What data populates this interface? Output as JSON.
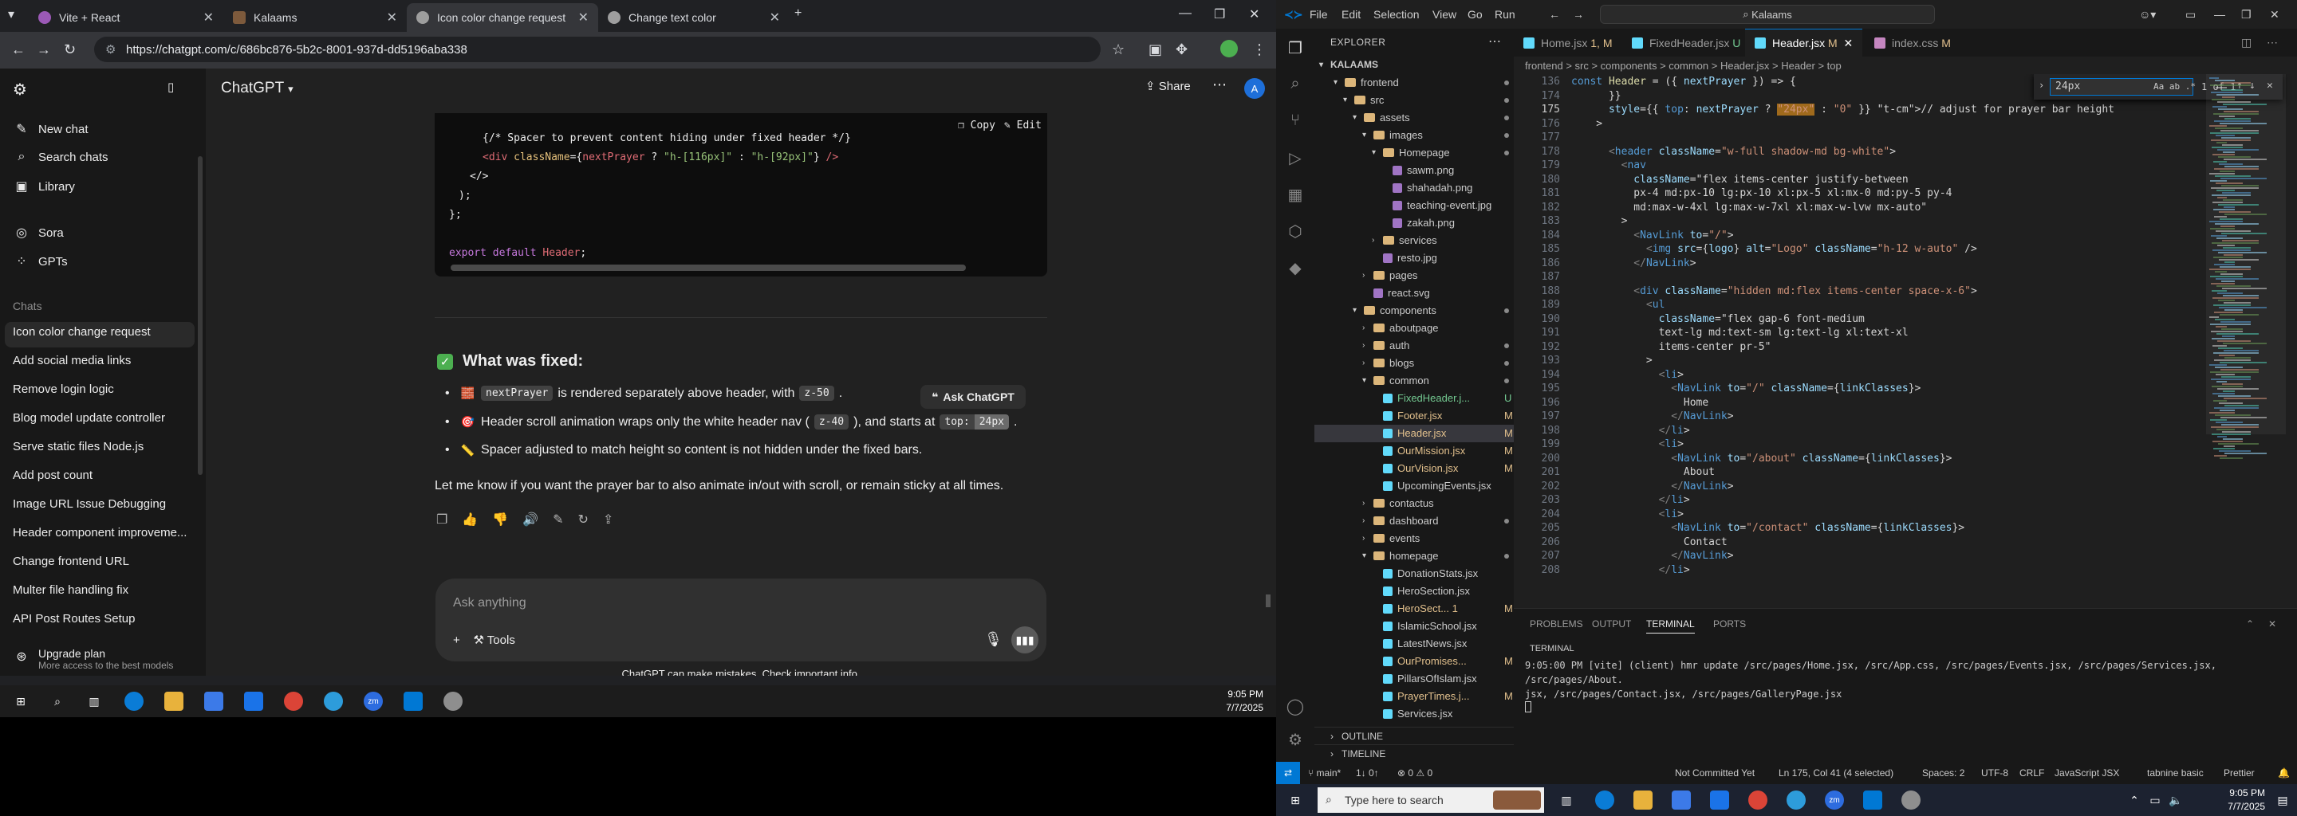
{
  "chrome": {
    "tabs": [
      {
        "title": "Vite + React",
        "color": "#9b59b6"
      },
      {
        "title": "Kalaams",
        "color": "#7d5a3c"
      },
      {
        "title": "Icon color change request",
        "color": "#9e9e9e"
      },
      {
        "title": "Change text color",
        "color": "#9e9e9e"
      }
    ],
    "new_tab": "+",
    "url": "https://chatgpt.com/c/686bc876-5b2c-8001-937d-dd5196aba338"
  },
  "chatgpt": {
    "sidebar": {
      "top_items": [
        {
          "label": "New chat",
          "icon": "edit-icon"
        },
        {
          "label": "Search chats",
          "icon": "search-icon"
        },
        {
          "label": "Library",
          "icon": "library-icon"
        },
        {
          "label": "Sora",
          "icon": "sora-icon"
        },
        {
          "label": "GPTs",
          "icon": "gpts-icon"
        }
      ],
      "chats_heading": "Chats",
      "chats": [
        "Icon color change request",
        "Add social media links",
        "Remove login logic",
        "Blog model update controller",
        "Serve static files Node.js",
        "Add post count",
        "Image URL Issue Debugging",
        "Header component improveme...",
        "Change frontend URL",
        "Multer file handling fix",
        "API Post Routes Setup"
      ],
      "upgrade_title": "Upgrade plan",
      "upgrade_sub": "More access to the best models"
    },
    "model": "ChatGPT",
    "share": "Share",
    "avatar": "A",
    "code_block": {
      "copy": "Copy",
      "edit": "Edit",
      "lines": [
        "{/* Spacer to prevent content hiding under fixed header */}",
        "<div className={nextPrayer ? \"h-[116px]\" : \"h-[92px]\"} />",
        "</>",
        ");",
        "};",
        "",
        "export default Header;"
      ]
    },
    "fixed_heading": "What was fixed:",
    "bullets": [
      {
        "emoji": "🧱",
        "code": "nextPrayer",
        "text_a": "is rendered separately above header, with",
        "code_b": "z-50",
        "text_b": "."
      },
      {
        "emoji": "🎯",
        "text_a": "Header scroll animation wraps only the white header nav (",
        "code": "z-40",
        "text_b": "), and starts at",
        "code_b": "top:",
        "code_c": "24px",
        "text_c": "."
      },
      {
        "emoji": "📏",
        "text_a": "Spacer adjusted to match height so content is not hidden under the fixed bars."
      }
    ],
    "closing": "Let me know if you want the prayer bar to also animate in/out with scroll, or remain sticky at all times.",
    "ask_chatgpt": "Ask ChatGPT",
    "composer_placeholder": "Ask anything",
    "tools": "Tools",
    "disclaimer": "ChatGPT can make mistakes. Check important info."
  },
  "taskbar_left": {
    "time": "9:05 PM",
    "date": "7/7/2025"
  },
  "vscode": {
    "menu": [
      "File",
      "Edit",
      "Selection",
      "View",
      "Go",
      "Run"
    ],
    "search": "Kalaams",
    "explorer_title": "EXPLORER",
    "root": "KALAAMS",
    "tree": [
      {
        "label": "frontend",
        "type": "folder",
        "depth": 1,
        "open": true,
        "badge": "dot"
      },
      {
        "label": "src",
        "type": "folder",
        "depth": 2,
        "open": true,
        "badge": "dot"
      },
      {
        "label": "assets",
        "type": "folder",
        "depth": 3,
        "open": true,
        "badge": "dot"
      },
      {
        "label": "images",
        "type": "folder",
        "depth": 4,
        "open": true,
        "badge": "dot"
      },
      {
        "label": "Homepage",
        "type": "folder",
        "depth": 5,
        "open": true,
        "badge": "dot"
      },
      {
        "label": "sawm.png",
        "type": "img",
        "depth": 6,
        "badge": ""
      },
      {
        "label": "shahadah.png",
        "type": "img",
        "depth": 6,
        "badge": ""
      },
      {
        "label": "teaching-event.jpg",
        "type": "img",
        "depth": 6,
        "badge": ""
      },
      {
        "label": "zakah.png",
        "type": "img",
        "depth": 6,
        "badge": ""
      },
      {
        "label": "services",
        "type": "folder",
        "depth": 5,
        "open": false,
        "badge": ""
      },
      {
        "label": "resto.jpg",
        "type": "img",
        "depth": 5,
        "badge": ""
      },
      {
        "label": "pages",
        "type": "folder",
        "depth": 4,
        "open": false,
        "badge": ""
      },
      {
        "label": "react.svg",
        "type": "img",
        "depth": 4,
        "badge": ""
      },
      {
        "label": "components",
        "type": "folder",
        "depth": 3,
        "open": true,
        "badge": "dot"
      },
      {
        "label": "aboutpage",
        "type": "folder",
        "depth": 4,
        "open": false,
        "badge": ""
      },
      {
        "label": "auth",
        "type": "folder",
        "depth": 4,
        "open": false,
        "badge": "dot"
      },
      {
        "label": "blogs",
        "type": "folder",
        "depth": 4,
        "open": false,
        "badge": "dot"
      },
      {
        "label": "common",
        "type": "folder",
        "depth": 4,
        "open": true,
        "badge": "dot"
      },
      {
        "label": "FixedHeader.j...",
        "type": "jsx",
        "depth": 5,
        "badge": "U"
      },
      {
        "label": "Footer.jsx",
        "type": "jsx",
        "depth": 5,
        "badge": "M"
      },
      {
        "label": "Header.jsx",
        "type": "jsx",
        "depth": 5,
        "badge": "M",
        "selected": true
      },
      {
        "label": "OurMission.jsx",
        "type": "jsx",
        "depth": 5,
        "badge": "M"
      },
      {
        "label": "OurVision.jsx",
        "type": "jsx",
        "depth": 5,
        "badge": "M"
      },
      {
        "label": "UpcomingEvents.jsx",
        "type": "jsx",
        "depth": 5,
        "badge": ""
      },
      {
        "label": "contactus",
        "type": "folder",
        "depth": 4,
        "open": false,
        "badge": ""
      },
      {
        "label": "dashboard",
        "type": "folder",
        "depth": 4,
        "open": false,
        "badge": "dot"
      },
      {
        "label": "events",
        "type": "folder",
        "depth": 4,
        "open": false,
        "badge": ""
      },
      {
        "label": "homepage",
        "type": "folder",
        "depth": 4,
        "open": true,
        "badge": "dot"
      },
      {
        "label": "DonationStats.jsx",
        "type": "jsx",
        "depth": 5,
        "badge": ""
      },
      {
        "label": "HeroSection.jsx",
        "type": "jsx",
        "depth": 5,
        "badge": ""
      },
      {
        "label": "HeroSect... 1",
        "type": "jsx",
        "depth": 5,
        "badge": "M"
      },
      {
        "label": "IslamicSchool.jsx",
        "type": "jsx",
        "depth": 5,
        "badge": ""
      },
      {
        "label": "LatestNews.jsx",
        "type": "jsx",
        "depth": 5,
        "badge": ""
      },
      {
        "label": "OurPromises...",
        "type": "jsx",
        "depth": 5,
        "badge": "M"
      },
      {
        "label": "PillarsOfIslam.jsx",
        "type": "jsx",
        "depth": 5,
        "badge": ""
      },
      {
        "label": "PrayerTimes.j...",
        "type": "jsx",
        "depth": 5,
        "badge": "M"
      },
      {
        "label": "Services.jsx",
        "type": "jsx",
        "depth": 5,
        "badge": ""
      }
    ],
    "outline": "OUTLINE",
    "timeline": "TIMELINE",
    "tabs": [
      {
        "label": "Home.jsx",
        "badge": "1, M",
        "color": "#61dafb"
      },
      {
        "label": "FixedHeader.jsx",
        "badge": "U",
        "color": "#61dafb"
      },
      {
        "label": "Header.jsx",
        "badge": "M",
        "color": "#61dafb",
        "active": true
      },
      {
        "label": "index.css",
        "badge": "M",
        "color": "#c586c0"
      }
    ],
    "breadcrumb": "frontend > src > components > common > Header.jsx > Header > top",
    "find": {
      "query": "24px",
      "count": "1 of 1"
    },
    "code_lines": [
      {
        "n": "136",
        "t": "const Header = ({ nextPrayer }) => {"
      },
      {
        "n": "174",
        "t": "      }}"
      },
      {
        "n": "175",
        "t": "      style={{ top: nextPrayer ? \"24px\" : \"0\" }} // adjust for prayer bar height"
      },
      {
        "n": "176",
        "t": "    >"
      },
      {
        "n": "177",
        "t": ""
      },
      {
        "n": "178",
        "t": "      <header className=\"w-full shadow-md bg-white\">"
      },
      {
        "n": "179",
        "t": "        <nav"
      },
      {
        "n": "180",
        "t": "          className=\"flex items-center justify-between"
      },
      {
        "n": "181",
        "t": "          px-4 md:px-10 lg:px-10 xl:px-5 xl:mx-0 md:py-5 py-4"
      },
      {
        "n": "182",
        "t": "          md:max-w-4xl lg:max-w-7xl xl:max-w-lvw mx-auto\""
      },
      {
        "n": "183",
        "t": "        >"
      },
      {
        "n": "184",
        "t": "          <NavLink to=\"/\">"
      },
      {
        "n": "185",
        "t": "            <img src={logo} alt=\"Logo\" className=\"h-12 w-auto\" />"
      },
      {
        "n": "186",
        "t": "          </NavLink>"
      },
      {
        "n": "187",
        "t": ""
      },
      {
        "n": "188",
        "t": "          <div className=\"hidden md:flex items-center space-x-6\">"
      },
      {
        "n": "189",
        "t": "            <ul"
      },
      {
        "n": "190",
        "t": "              className=\"flex gap-6 font-medium"
      },
      {
        "n": "191",
        "t": "              text-lg md:text-sm lg:text-lg xl:text-xl"
      },
      {
        "n": "192",
        "t": "              items-center pr-5\""
      },
      {
        "n": "193",
        "t": "            >"
      },
      {
        "n": "194",
        "t": "              <li>"
      },
      {
        "n": "195",
        "t": "                <NavLink to=\"/\" className={linkClasses}>"
      },
      {
        "n": "196",
        "t": "                  Home"
      },
      {
        "n": "197",
        "t": "                </NavLink>"
      },
      {
        "n": "198",
        "t": "              </li>"
      },
      {
        "n": "199",
        "t": "              <li>"
      },
      {
        "n": "200",
        "t": "                <NavLink to=\"/about\" className={linkClasses}>"
      },
      {
        "n": "201",
        "t": "                  About"
      },
      {
        "n": "202",
        "t": "                </NavLink>"
      },
      {
        "n": "203",
        "t": "              </li>"
      },
      {
        "n": "204",
        "t": "              <li>"
      },
      {
        "n": "205",
        "t": "                <NavLink to=\"/contact\" className={linkClasses}>"
      },
      {
        "n": "206",
        "t": "                  Contact"
      },
      {
        "n": "207",
        "t": "                </NavLink>"
      },
      {
        "n": "208",
        "t": "              </li>"
      }
    ],
    "panel_tabs": [
      "PROBLEMS",
      "OUTPUT",
      "TERMINAL",
      "PORTS"
    ],
    "terminal_title": "TERMINAL",
    "terminal_lines": [
      "9:05:00 PM [vite] (client) hmr update /src/pages/Home.jsx, /src/App.css, /src/pages/Events.jsx, /src/pages/Services.jsx, /src/pages/About.",
      "jsx, /src/pages/Contact.jsx, /src/pages/GalleryPage.jsx"
    ],
    "status": {
      "branch": "main*",
      "sync": "1↓ 0↑",
      "problems": "⊗ 0 ⚠ 0",
      "not_committed": "Not Committed Yet",
      "cursor": "Ln 175, Col 41 (4 selected)",
      "spaces": "Spaces: 2",
      "encoding": "UTF-8",
      "eol": "CRLF",
      "language": "JavaScript JSX",
      "tabnine": "tabnine basic",
      "prettier": "Prettier"
    }
  },
  "taskbar_right": {
    "search_placeholder": "Type here to search",
    "time": "9:05 PM",
    "date": "7/7/2025"
  }
}
